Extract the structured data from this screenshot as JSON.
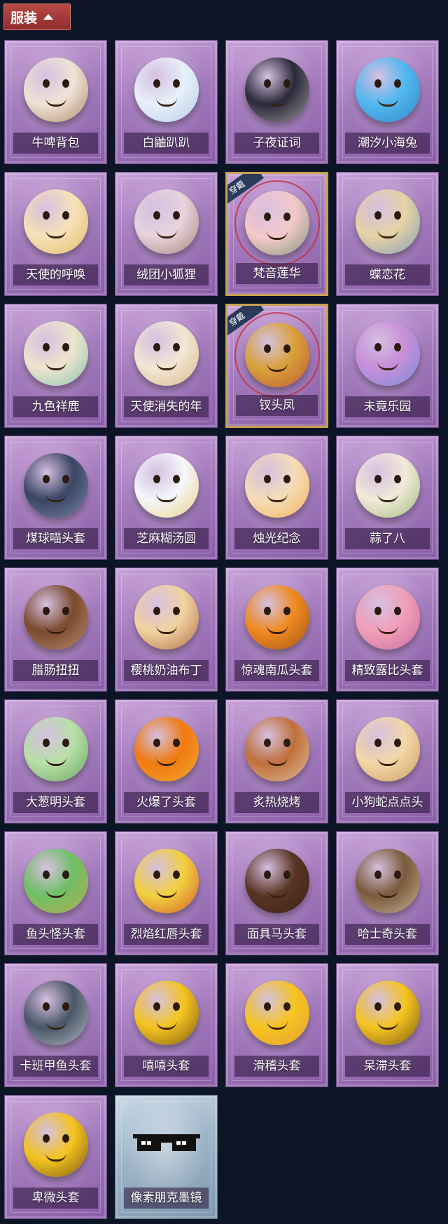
{
  "header": {
    "label": "服装",
    "icon": "chevron-up-icon"
  },
  "worn_badge": "穿戴",
  "items": [
    {
      "name": "牛啤背包",
      "color": "#f0e3d6",
      "accent": "#8a5a30",
      "worn": false,
      "style": "purple"
    },
    {
      "name": "白鼬趴趴",
      "color": "#e8f1fb",
      "accent": "#9ab8d6",
      "worn": false,
      "style": "purple"
    },
    {
      "name": "子夜证词",
      "color": "#2b2a3a",
      "accent": "#d9d0c8",
      "worn": false,
      "style": "purple"
    },
    {
      "name": "潮汐小海兔",
      "color": "#53b8f0",
      "accent": "#1d6fb0",
      "worn": false,
      "style": "purple"
    },
    {
      "name": "天使的呼唤",
      "color": "#f7e2b8",
      "accent": "#d8a640",
      "worn": false,
      "style": "purple"
    },
    {
      "name": "绒团小狐狸",
      "color": "#e7d4dc",
      "accent": "#8a5a48",
      "worn": false,
      "style": "purple"
    },
    {
      "name": "梵音莲华",
      "color": "#f5c9c9",
      "accent": "#3f7a55",
      "worn": true,
      "style": "purple"
    },
    {
      "name": "蝶恋花",
      "color": "#e6d3a6",
      "accent": "#4f80b8",
      "worn": false,
      "style": "purple"
    },
    {
      "name": "九色祥鹿",
      "color": "#efe4cc",
      "accent": "#4cb3a8",
      "worn": false,
      "style": "purple"
    },
    {
      "name": "天使消失的年",
      "color": "#f3e7d6",
      "accent": "#c9a060",
      "worn": false,
      "style": "purple"
    },
    {
      "name": "钗头凤",
      "color": "#d9a13a",
      "accent": "#b23030",
      "worn": true,
      "style": "purple"
    },
    {
      "name": "未竟乐园",
      "color": "#c88fd8",
      "accent": "#4f8de0",
      "worn": false,
      "style": "purple"
    },
    {
      "name": "煤球喵头套",
      "color": "#3a4564",
      "accent": "#9aa6c8",
      "worn": false,
      "style": "purple"
    },
    {
      "name": "芝麻糊汤圆",
      "color": "#f4f7fb",
      "accent": "#e4b840",
      "worn": false,
      "style": "purple"
    },
    {
      "name": "烛光纪念",
      "color": "#f5ddb7",
      "accent": "#f29a30",
      "worn": false,
      "style": "purple"
    },
    {
      "name": "蒜了八",
      "color": "#f3ead9",
      "accent": "#6fa350",
      "worn": false,
      "style": "purple"
    },
    {
      "name": "腊肠扭扭",
      "color": "#7b4a2e",
      "accent": "#d9b090",
      "worn": false,
      "style": "purple"
    },
    {
      "name": "樱桃奶油布丁",
      "color": "#f3d3a0",
      "accent": "#8a3a1a",
      "worn": false,
      "style": "purple"
    },
    {
      "name": "惊魂南瓜头套",
      "color": "#f08a20",
      "accent": "#7a3a10",
      "worn": false,
      "style": "purple"
    },
    {
      "name": "精致露比头套",
      "color": "#f0a0b8",
      "accent": "#b85090",
      "worn": false,
      "style": "purple"
    },
    {
      "name": "大葱明头套",
      "color": "#b9e0a8",
      "accent": "#3e8a3a",
      "worn": false,
      "style": "purple"
    },
    {
      "name": "火爆了头套",
      "color": "#f07a10",
      "accent": "#f5c040",
      "worn": false,
      "style": "purple"
    },
    {
      "name": "炙热烧烤",
      "color": "#c0703a",
      "accent": "#efe6d6",
      "worn": false,
      "style": "purple"
    },
    {
      "name": "小狗蛇点点头",
      "color": "#f3d7a8",
      "accent": "#b8803a",
      "worn": false,
      "style": "purple"
    },
    {
      "name": "鱼头怪头套",
      "color": "#6fbf64",
      "accent": "#e0a04a",
      "worn": false,
      "style": "purple"
    },
    {
      "name": "烈焰红唇头套",
      "color": "#f2d040",
      "accent": "#c22020",
      "worn": false,
      "style": "purple"
    },
    {
      "name": "面具马头套",
      "color": "#5a3424",
      "accent": "#2a1a12",
      "worn": false,
      "style": "purple"
    },
    {
      "name": "哈士奇头套",
      "color": "#7a5a3a",
      "accent": "#f0e0c8",
      "worn": false,
      "style": "purple"
    },
    {
      "name": "卡班甲鱼头套",
      "color": "#4a5666",
      "accent": "#e8eef4",
      "worn": false,
      "style": "purple"
    },
    {
      "name": "嘻嘻头套",
      "color": "#f5c420",
      "accent": "#3a2010",
      "worn": false,
      "style": "purple"
    },
    {
      "name": "滑稽头套",
      "color": "#f5c420",
      "accent": "#e08a40",
      "worn": false,
      "style": "purple"
    },
    {
      "name": "呆滞头套",
      "color": "#f5c420",
      "accent": "#3a2010",
      "worn": false,
      "style": "purple"
    },
    {
      "name": "卑微头套",
      "color": "#f5c420",
      "accent": "#3a2010",
      "worn": false,
      "style": "purple"
    },
    {
      "name": "像素朋克墨镜",
      "color": "#111111",
      "accent": "#ffffff",
      "worn": false,
      "style": "blue"
    }
  ]
}
